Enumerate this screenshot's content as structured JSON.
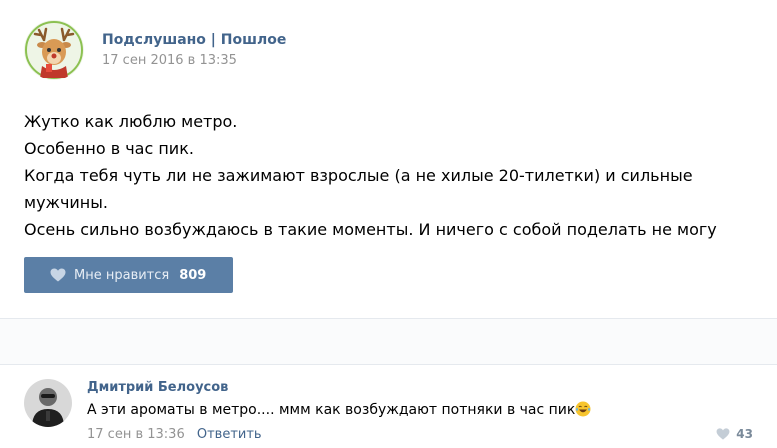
{
  "post": {
    "group_name": "Подслушано | Пошлое",
    "date": "17 сен 2016 в 13:35",
    "text_lines": [
      "Жутко как люблю метро.",
      "Особенно в час пик.",
      "Когда тебя чуть ли не зажимают взрослые (а не хилые 20-тилетки) и сильные",
      "мужчины.",
      "Осень сильно возбуждаюсь в такие моменты. И ничего с собой поделать не могу"
    ],
    "like": {
      "label": "Мне нравится",
      "count": "809",
      "icon": "heart-icon"
    }
  },
  "comment": {
    "author": "Дмитрий Белоусов",
    "text": "А эти ароматы в метро.... ммм как возбуждают потняки в час пик",
    "emoji": "laughing-tears-emoji",
    "date": "17 сен в 13:36",
    "reply_label": "Ответить",
    "likes": "43"
  },
  "colors": {
    "link": "#42648b",
    "like_button": "#5b7fa6",
    "muted": "#939393"
  }
}
